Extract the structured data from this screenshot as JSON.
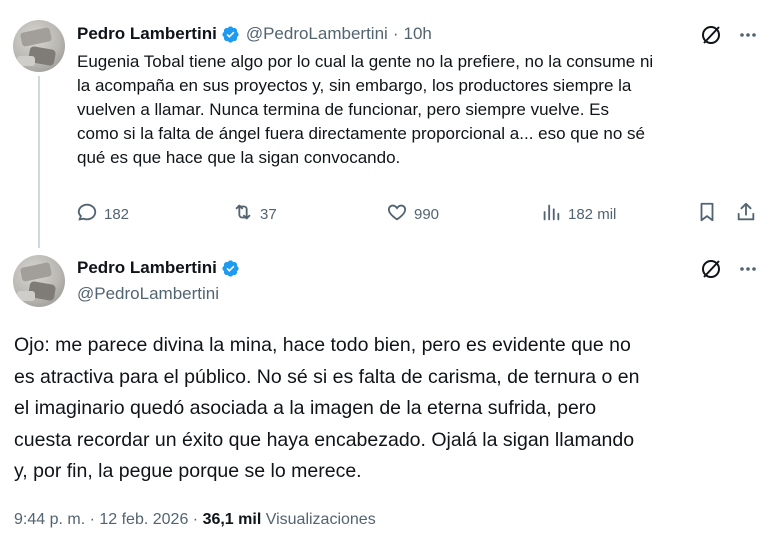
{
  "colors": {
    "verified_blue": "#1d9bf0",
    "secondary_text": "#536471",
    "primary_text": "#0f1419"
  },
  "tweet1": {
    "author_name": "Pedro Lambertini",
    "handle": "@PedroLambertini",
    "separator": "·",
    "time": "10h",
    "text": "Eugenia Tobal tiene algo por lo cual la gente no la prefiere, no la consume ni\nla acompaña en sus proyectos y, sin embargo, los productores siempre la\nvuelven a llamar. Nunca termina de funcionar, pero siempre vuelve. Es\ncomo si la falta de ángel fuera directamente proporcional a... eso que no sé\nqué es que hace que la sigan convocando.",
    "replies": "182",
    "reposts": "37",
    "likes": "990",
    "views": "182 mil",
    "icons": [
      "grok-icon",
      "more-icon",
      "reply-icon",
      "repost-icon",
      "like-icon",
      "views-icon",
      "bookmark-icon",
      "share-icon"
    ]
  },
  "tweet2": {
    "author_name": "Pedro Lambertini",
    "handle": "@PedroLambertini",
    "text": "Ojo: me parece divina la mina, hace todo bien, pero es evidente que no\nes atractiva para el público. No sé si es falta de carisma, de ternura o en\nel imaginario quedó asociada a la imagen de la eterna sufrida, pero\ncuesta recordar un éxito que haya encabezado. Ojalá la sigan llamando\ny, por fin, la pegue porque se lo merece.",
    "timestamp": "9:44 p. m. · 12 feb. 2026 · ",
    "view_count": "36,1 mil",
    "view_label": " Visualizaciones"
  }
}
